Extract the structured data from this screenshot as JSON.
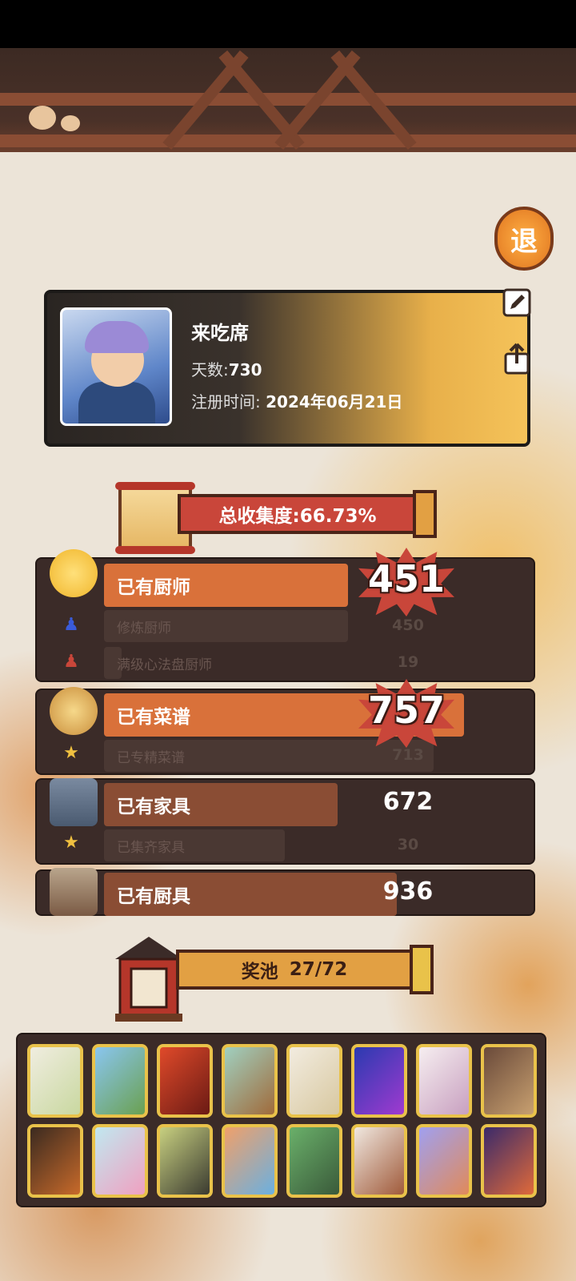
{
  "profile": {
    "name": "来吃席",
    "days_label": "天数:",
    "days_value": "730",
    "register_label": "注册时间:",
    "register_value": "2024年06月21日"
  },
  "exit_button_label": "退",
  "total": {
    "label": "总收集度:66.73%"
  },
  "chefs": {
    "label": "已有厨师",
    "value": "451",
    "sub": [
      {
        "label": "修炼厨师",
        "value": "450"
      },
      {
        "label": "满级心法盘厨师",
        "value": "19"
      }
    ]
  },
  "recipes": {
    "label": "已有菜谱",
    "value": "757",
    "sub": [
      {
        "label": "已专精菜谱",
        "value": "713"
      }
    ]
  },
  "furniture": {
    "label": "已有家具",
    "value": "672",
    "sub": [
      {
        "label": "已集齐家具",
        "value": "30"
      }
    ]
  },
  "utensils": {
    "label": "已有厨具",
    "value": "936"
  },
  "pool": {
    "label": "奖池",
    "count": "27/72"
  },
  "colors": {
    "accent_red": "#c9463a",
    "bar_orange": "#d9713a",
    "bar_brown": "#8a4d34",
    "gold": "#e9c24a"
  },
  "icons": [
    "exit-icon",
    "edit-icon",
    "share-icon",
    "chef-icon",
    "blue-figure-icon",
    "red-figure-icon",
    "pudding-icon",
    "star-icon",
    "furniture-icon",
    "utensil-icon",
    "gift-house-icon",
    "scroll-icon"
  ]
}
